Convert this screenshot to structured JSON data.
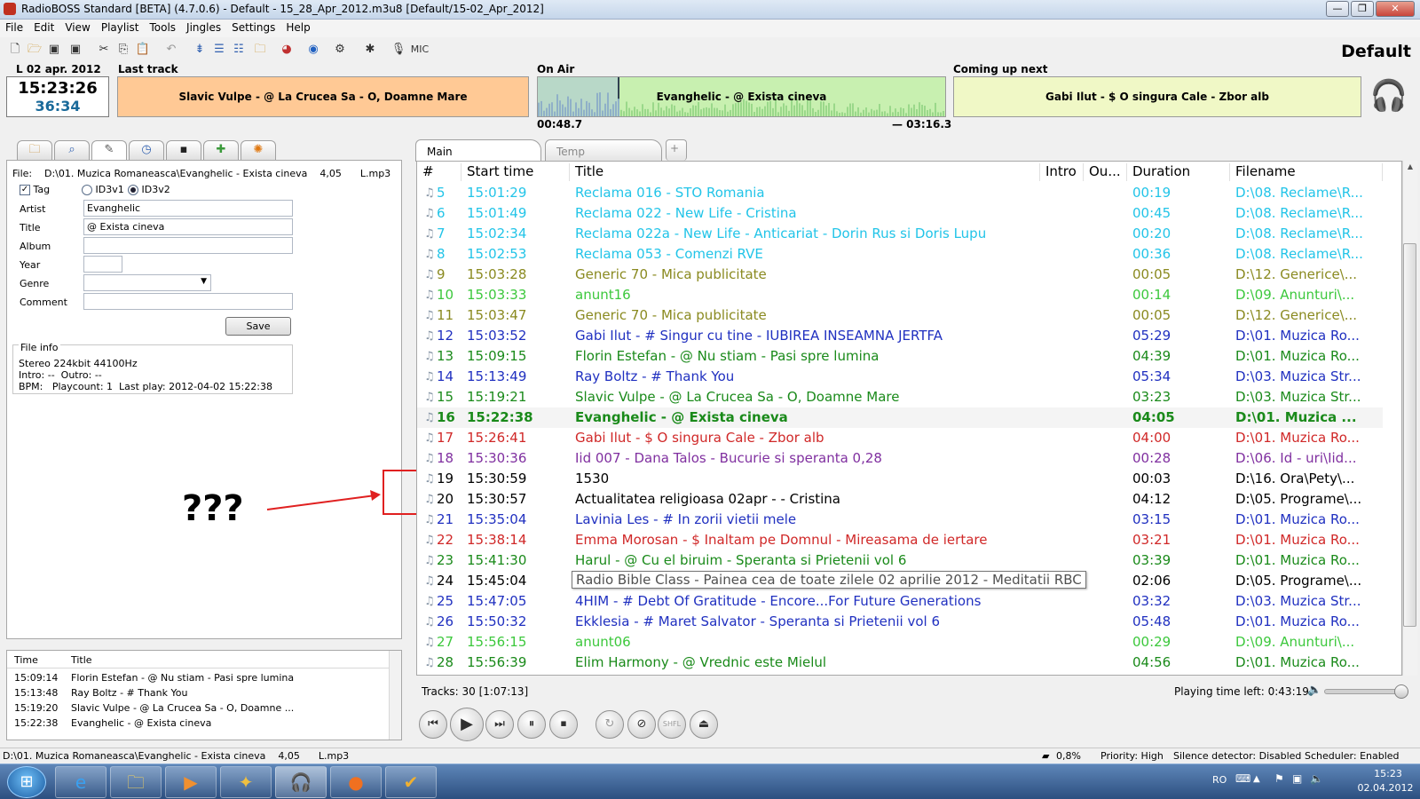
{
  "window": {
    "title": "RadioBOSS Standard [BETA] (4.7.0.6) - Default - 15_28_Apr_2012.m3u8 [Default/15-02_Apr_2012]",
    "minimize": "—",
    "maximize": "❐",
    "close": "✕"
  },
  "menu": [
    "File",
    "Edit",
    "View",
    "Playlist",
    "Tools",
    "Jingles",
    "Settings",
    "Help"
  ],
  "toolbar": {
    "mic_label": "MIC",
    "profile": "Default",
    "icons": [
      "new-file-icon",
      "open-folder-icon",
      "save-icon",
      "save-as-icon",
      "cut-icon",
      "copy-icon",
      "paste-icon",
      "undo-icon",
      "insert-icon",
      "import-icon",
      "playlist-icon",
      "folder-add-icon",
      "stream-icon",
      "globe-icon",
      "settings-icon",
      "mix-icon",
      "mic-icon"
    ]
  },
  "clock": {
    "date": "L 02 apr. 2012",
    "time": "15:23:26",
    "elapsed": "36:34"
  },
  "last_track": {
    "label": "Last track",
    "text": "Slavic Vulpe -  @ La Crucea Sa - O, Doamne Mare"
  },
  "on_air": {
    "label": "On Air",
    "text": "Evanghelic -  @ Exista cineva",
    "elapsed": "00:48.7",
    "remaining": "— 03:16.3",
    "progress": 0.2
  },
  "next": {
    "label": "Coming up next",
    "text": "Gabi Ilut -  $ O singura Cale - Zbor alb"
  },
  "left_tabs": [
    "folder-tab-icon",
    "search-tab-icon",
    "tag-tab-icon",
    "clock-tab-icon",
    "media-tab-icon",
    "plugin-tab-icon",
    "options-tab-icon"
  ],
  "tag_editor": {
    "file_label": "File:",
    "file_path": "D:\\01. Muzica Romaneasca\\Evanghelic - Exista cineva    4,05      L.mp3",
    "tag_label": "Tag",
    "tag_checked": true,
    "id3v1": "ID3v1",
    "id3v2": "ID3v2",
    "id3_selected": "ID3v2",
    "artist_label": "Artist",
    "artist": "Evanghelic",
    "title_label": "Title",
    "title": "@ Exista cineva",
    "album_label": "Album",
    "album": "",
    "year_label": "Year",
    "year": "",
    "genre_label": "Genre",
    "genre": "",
    "comment_label": "Comment",
    "comment": "",
    "save": "Save",
    "fileinfo_label": "File info",
    "fileinfo_line1": "Stereo 224kbit 44100Hz",
    "fileinfo_line2": "Intro: --  Outro: --",
    "fileinfo_line3": "BPM:   Playcount: 1  Last play: 2012-04-02 15:22:38"
  },
  "annotation": "???",
  "history": {
    "headers": [
      "Time",
      "Title"
    ],
    "rows": [
      {
        "time": "15:09:14",
        "title": "Florin Estefan -  @ Nu stiam - Pasi spre lumina"
      },
      {
        "time": "15:13:48",
        "title": "Ray Boltz -  # Thank You"
      },
      {
        "time": "15:19:20",
        "title": "Slavic Vulpe -  @ La Crucea Sa - O, Doamne ..."
      },
      {
        "time": "15:22:38",
        "title": "Evanghelic -  @ Exista cineva"
      }
    ]
  },
  "playlist_tabs": [
    "Main",
    "Temp",
    "+"
  ],
  "playlist": {
    "headers": [
      "#",
      "Start time",
      "Title",
      "Intro",
      "Ou...",
      "Duration",
      "Filename"
    ],
    "rows": [
      {
        "n": "5",
        "start": "15:01:29",
        "title": "Reclama 016 -  STO Romania",
        "dur": "00:19",
        "file": "D:\\08. Reclame\\R...",
        "color": "#22c4e8"
      },
      {
        "n": "6",
        "start": "15:01:49",
        "title": "Reclama 022 -  New Life - Cristina",
        "dur": "00:45",
        "file": "D:\\08. Reclame\\R...",
        "color": "#22c4e8"
      },
      {
        "n": "7",
        "start": "15:02:34",
        "title": "Reclama 022a -  New Life - Anticariat - Dorin Rus si Doris Lupu",
        "dur": "00:20",
        "file": "D:\\08. Reclame\\R...",
        "color": "#22c4e8"
      },
      {
        "n": "8",
        "start": "15:02:53",
        "title": "Reclama 053 - Comenzi RVE",
        "dur": "00:36",
        "file": "D:\\08. Reclame\\R...",
        "color": "#22c4e8"
      },
      {
        "n": "9",
        "start": "15:03:28",
        "title": "Generic 70 - Mica publicitate",
        "dur": "00:05",
        "file": "D:\\12. Generice\\...",
        "color": "#8a8a20"
      },
      {
        "n": "10",
        "start": "15:03:33",
        "title": "anunt16",
        "dur": "00:14",
        "file": "D:\\09. Anunturi\\...",
        "color": "#3cc83c"
      },
      {
        "n": "11",
        "start": "15:03:47",
        "title": "Generic 70 - Mica publicitate",
        "dur": "00:05",
        "file": "D:\\12. Generice\\...",
        "color": "#8a8a20"
      },
      {
        "n": "12",
        "start": "15:03:52",
        "title": "Gabi Ilut -  # Singur cu tine - IUBIREA INSEAMNA JERTFA",
        "dur": "05:29",
        "file": "D:\\01. Muzica Ro...",
        "color": "#2030c0"
      },
      {
        "n": "13",
        "start": "15:09:15",
        "title": "Florin Estefan -  @ Nu stiam - Pasi spre lumina",
        "dur": "04:39",
        "file": "D:\\01. Muzica Ro...",
        "color": "#1a8a1a"
      },
      {
        "n": "14",
        "start": "15:13:49",
        "title": "Ray Boltz -  # Thank You",
        "dur": "05:34",
        "file": "D:\\03. Muzica Str...",
        "color": "#2030c0"
      },
      {
        "n": "15",
        "start": "15:19:21",
        "title": "Slavic Vulpe -  @ La Crucea Sa - O, Doamne Mare",
        "dur": "03:23",
        "file": "D:\\03. Muzica Str...",
        "color": "#1a8a1a"
      },
      {
        "n": "16",
        "start": "15:22:38",
        "title": "Evanghelic -  @ Exista cineva",
        "dur": "04:05",
        "file": "D:\\01. Muzica ...",
        "color": "#1a8a1a",
        "current": true
      },
      {
        "n": "17",
        "start": "15:26:41",
        "title": "Gabi Ilut -  $ O singura Cale - Zbor alb",
        "dur": "04:00",
        "file": "D:\\01. Muzica Ro...",
        "color": "#d02828"
      },
      {
        "n": "18",
        "start": "15:30:36",
        "title": "Iid 007 - Dana Talos - Bucurie si speranta        0,28",
        "dur": "00:28",
        "file": "D:\\06. Id - uri\\Iid...",
        "color": "#8030a0"
      },
      {
        "n": "19",
        "start": "15:30:59",
        "title": "1530",
        "dur": "00:03",
        "file": "D:\\16. Ora\\Pety\\...",
        "color": "#000000"
      },
      {
        "n": "20",
        "start": "15:30:57",
        "title": "Actualitatea religioasa 02apr -    - Cristina",
        "dur": "04:12",
        "file": "D:\\05. Programe\\...",
        "color": "#000000"
      },
      {
        "n": "21",
        "start": "15:35:04",
        "title": "Lavinia Les -  # In zorii vietii mele",
        "dur": "03:15",
        "file": "D:\\01. Muzica Ro...",
        "color": "#2030c0"
      },
      {
        "n": "22",
        "start": "15:38:14",
        "title": "Emma Morosan -  $ Inaltam pe Domnul - Mireasama de iertare",
        "dur": "03:21",
        "file": "D:\\01. Muzica Ro...",
        "color": "#d02828"
      },
      {
        "n": "23",
        "start": "15:41:30",
        "title": "Harul -  @ Cu el biruim - Speranta si Prietenii vol 6",
        "dur": "03:39",
        "file": "D:\\01. Muzica Ro...",
        "color": "#1a8a1a"
      },
      {
        "n": "24",
        "start": "15:45:04",
        "title": "Radio Bible Class -  Painea cea de toate zilele 02 aprilie 2012 - Meditatii RBC",
        "dur": "02:06",
        "file": "D:\\05. Programe\\...",
        "color": "#000000",
        "tooltip": true
      },
      {
        "n": "25",
        "start": "15:47:05",
        "title": "4HIM -  # Debt Of Gratitude - Encore...For Future Generations",
        "dur": "03:32",
        "file": "D:\\03. Muzica Str...",
        "color": "#2030c0"
      },
      {
        "n": "26",
        "start": "15:50:32",
        "title": "Ekklesia -  # Maret Salvator - Speranta si Prietenii vol 6",
        "dur": "05:48",
        "file": "D:\\01. Muzica Ro...",
        "color": "#2030c0"
      },
      {
        "n": "27",
        "start": "15:56:15",
        "title": "anunt06",
        "dur": "00:29",
        "file": "D:\\09. Anunturi\\...",
        "color": "#3cc83c"
      },
      {
        "n": "28",
        "start": "15:56:39",
        "title": "Elim Harmony -  @ Vrednic este Mielul",
        "dur": "04:56",
        "file": "D:\\01. Muzica Ro...",
        "color": "#1a8a1a"
      }
    ]
  },
  "tracks_info": "Tracks: 30 [1:07:13]",
  "playing_left": "Playing time left: 0:43:19",
  "volume": 0.95,
  "player_buttons": [
    "previous-icon",
    "play-icon",
    "next-icon",
    "pause-icon",
    "stop-icon",
    "loop-icon",
    "disable-icon",
    "shuffle-icon",
    "eject-icon"
  ],
  "player_glyphs": [
    "⏮",
    "▶",
    "⏭",
    "⏸",
    "⏹",
    "↻",
    "⊘",
    "SHFL",
    "⏏"
  ],
  "statusbar": {
    "path": "D:\\01. Muzica Romaneasca\\Evanghelic - Exista cineva    4,05      L.mp3",
    "cpu": "0,8%",
    "priority": "Priority: High",
    "silence": "Silence detector: Disabled",
    "scheduler": "Scheduler: Enabled"
  },
  "taskbar": {
    "start": "⊞",
    "apps": [
      "ie-icon",
      "explorer-icon",
      "media-player-icon",
      "tool-icon",
      "radioboss-icon",
      "firefox-icon",
      "check-icon"
    ],
    "app_glyphs": [
      "e",
      "🗀",
      "▶",
      "✦",
      "🎧",
      "●",
      "✔"
    ],
    "lang": "RO",
    "time": "15:23",
    "date": "02.04.2012"
  }
}
